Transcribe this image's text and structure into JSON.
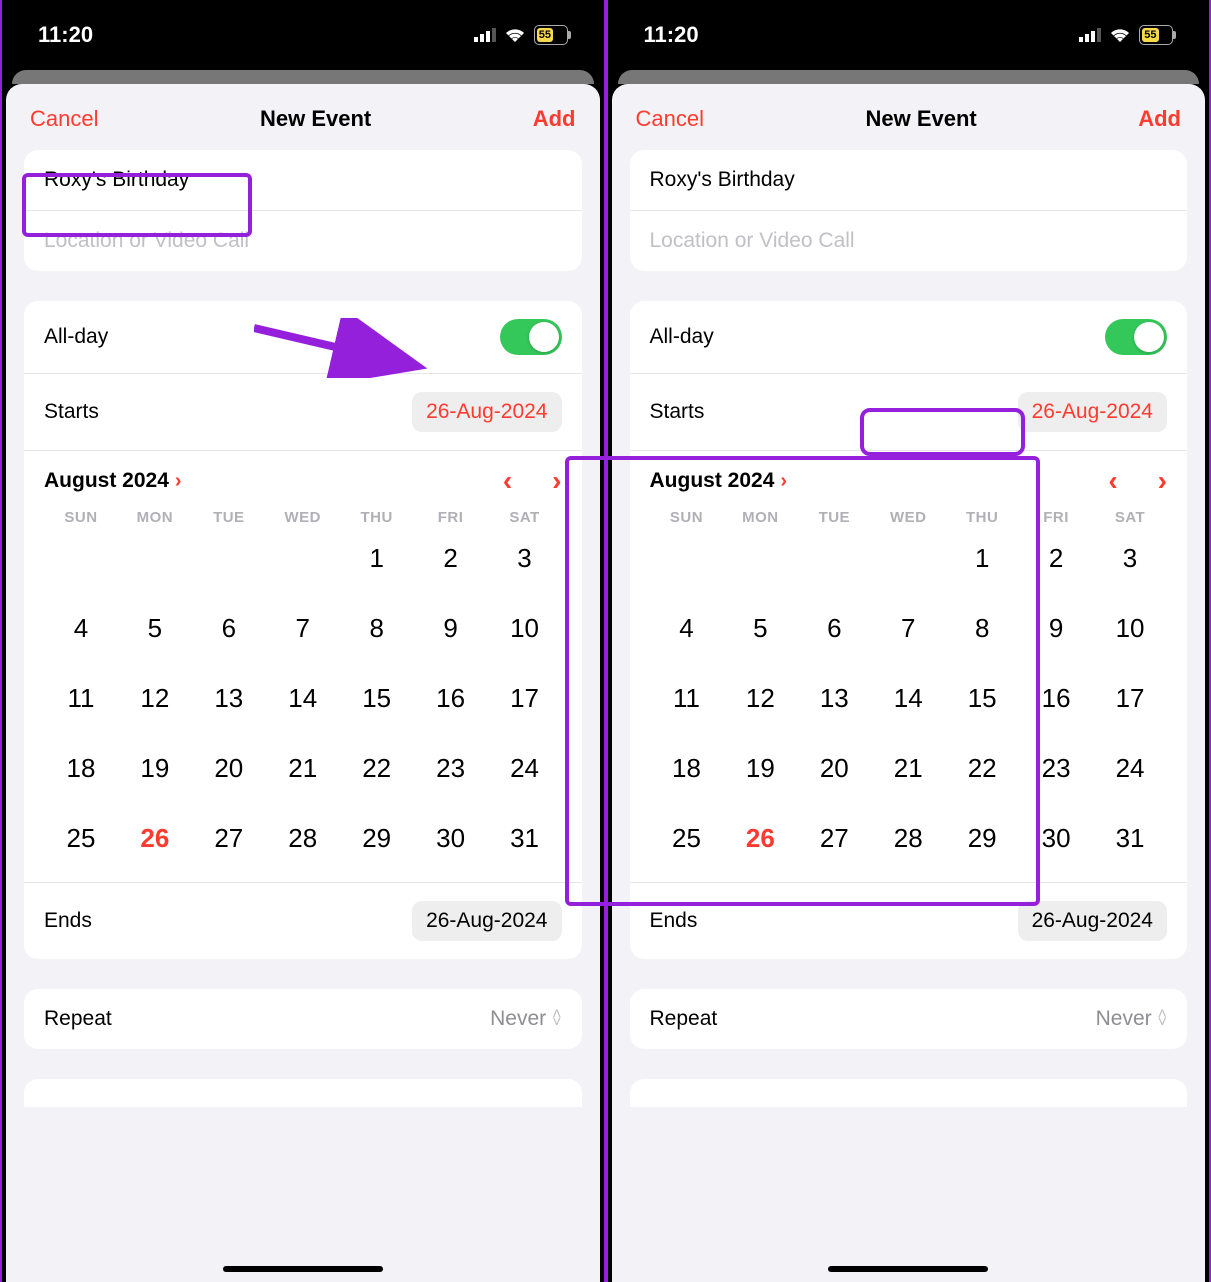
{
  "status": {
    "time": "11:20",
    "battery": "55"
  },
  "header": {
    "cancel": "Cancel",
    "title": "New Event",
    "add": "Add"
  },
  "event": {
    "title": "Roxy's Birthday",
    "location_placeholder": "Location or Video Call"
  },
  "allday": {
    "label": "All-day",
    "on": true
  },
  "starts": {
    "label": "Starts",
    "value": "26-Aug-2024"
  },
  "ends": {
    "label": "Ends",
    "value": "26-Aug-2024"
  },
  "calendar": {
    "month_label": "August 2024",
    "weekdays": [
      "SUN",
      "MON",
      "TUE",
      "WED",
      "THU",
      "FRI",
      "SAT"
    ],
    "leading_blanks": 4,
    "days": [
      1,
      2,
      3,
      4,
      5,
      6,
      7,
      8,
      9,
      10,
      11,
      12,
      13,
      14,
      15,
      16,
      17,
      18,
      19,
      20,
      21,
      22,
      23,
      24,
      25,
      26,
      27,
      28,
      29,
      30,
      31
    ],
    "selected": 26
  },
  "repeat": {
    "label": "Repeat",
    "value": "Never"
  }
}
